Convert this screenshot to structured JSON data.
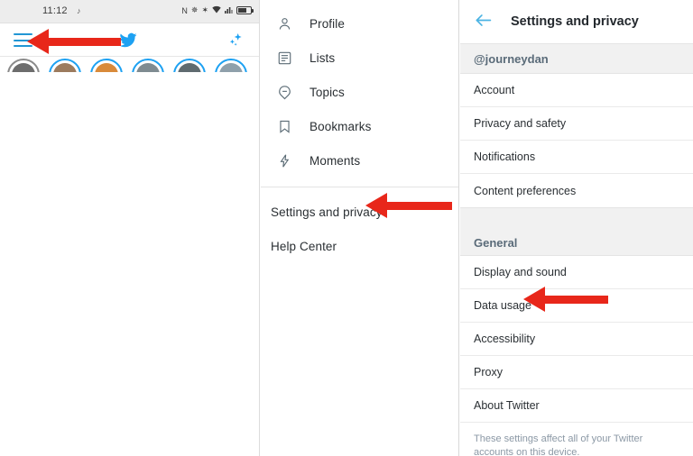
{
  "left_panel": {
    "name": "twitter-home-screen",
    "statusbar": {
      "time": "11:12",
      "mute_icon": "mute-icon",
      "icons": [
        "nfc-icon",
        "location-icon",
        "bluetooth-icon",
        "wifi-icon",
        "cellular-signal-icon",
        "battery-icon"
      ],
      "nfc_label": "N",
      "location_label": "✵",
      "bluetooth_label": "✶",
      "wifi_label": "◢",
      "signal_label": "▃▅",
      "background": "#ededed"
    },
    "toolbar": {
      "hamburger_icon": "hamburger-menu-icon",
      "logo_icon": "twitter-bird-icon",
      "sparkle_icon": "sparkles-icon",
      "accent_color": "#1da1f2"
    },
    "stories_row": {
      "count": 6,
      "ring_color": "#1da1f2"
    }
  },
  "mid_panel": {
    "name": "twitter-nav-drawer",
    "items": [
      {
        "label": "Profile",
        "icon": "person-icon"
      },
      {
        "label": "Lists",
        "icon": "list-icon"
      },
      {
        "label": "Topics",
        "icon": "topic-pin-icon"
      },
      {
        "label": "Bookmarks",
        "icon": "bookmark-icon"
      },
      {
        "label": "Moments",
        "icon": "lightning-bolt-icon"
      }
    ],
    "footer_items": [
      {
        "label": "Settings and privacy"
      },
      {
        "label": "Help Center"
      }
    ]
  },
  "right_panel": {
    "name": "settings-and-privacy-screen",
    "header": {
      "back_icon": "back-arrow-icon",
      "title": "Settings and privacy",
      "back_color": "#4bb3e3"
    },
    "account_section": {
      "header": "@journeydan",
      "rows": [
        "Account",
        "Privacy and safety",
        "Notifications",
        "Content preferences"
      ]
    },
    "general_section": {
      "header": "General",
      "rows": [
        "Display and sound",
        "Data usage",
        "Accessibility",
        "Proxy",
        "About Twitter"
      ]
    },
    "footer_note": "These settings affect all of your Twitter accounts on this device."
  },
  "annotations": {
    "color": "#e8271a",
    "arrows": [
      {
        "name": "arrow-to-hamburger-menu",
        "target": "hamburger-menu-icon"
      },
      {
        "name": "arrow-to-settings-and-privacy",
        "target": "settings-and-privacy-menu-item"
      },
      {
        "name": "arrow-to-data-usage",
        "target": "data-usage-row"
      }
    ]
  }
}
